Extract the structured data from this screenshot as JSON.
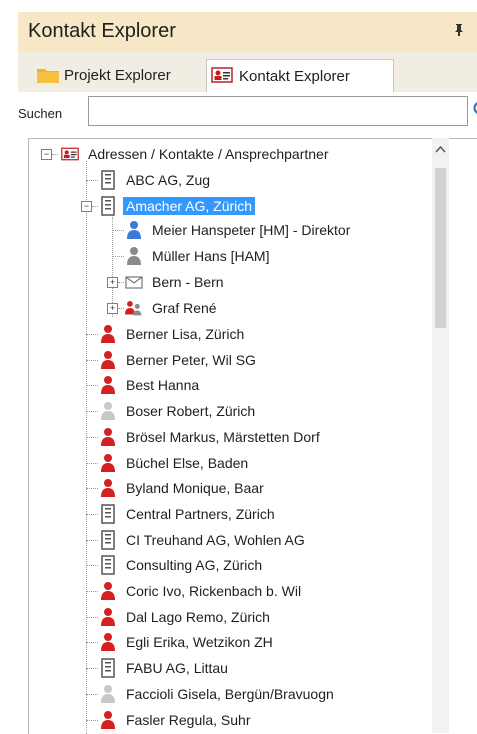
{
  "panel": {
    "title": "Kontakt Explorer",
    "pin_glyph": "↑ ×"
  },
  "tabs": [
    {
      "label": "Projekt Explorer",
      "icon": "folder-icon"
    },
    {
      "label": "Kontakt Explorer",
      "icon": "contact-card-icon",
      "active": true
    }
  ],
  "search": {
    "label": "Suchen",
    "value": "",
    "placeholder": ""
  },
  "tree": {
    "root": {
      "label": "Adressen / Kontakte / Ansprechpartner",
      "icon": "contact-card-icon",
      "expanded": true
    },
    "items": [
      {
        "label": "ABC AG, Zug",
        "icon": "building-icon"
      },
      {
        "label": "Amacher AG, Zürich",
        "icon": "building-icon",
        "selected": true,
        "expanded": true
      },
      {
        "label": "Meier Hanspeter [HM] - Direktor",
        "icon": "person-blue-icon"
      },
      {
        "label": "Müller Hans [HAM]",
        "icon": "person-gray-icon"
      },
      {
        "label": "Bern - Bern",
        "icon": "envelope-icon"
      },
      {
        "label": "Graf René",
        "icon": "people-icon"
      },
      {
        "label": "Berner Lisa, Zürich",
        "icon": "person-red-icon"
      },
      {
        "label": "Berner Peter, Wil SG",
        "icon": "person-red-icon"
      },
      {
        "label": "Best Hanna",
        "icon": "person-red-icon"
      },
      {
        "label": "Boser Robert, Zürich",
        "icon": "person-lightgray-icon"
      },
      {
        "label": "Brösel Markus, Märstetten Dorf",
        "icon": "person-red-icon"
      },
      {
        "label": "Büchel Else, Baden",
        "icon": "person-red-icon"
      },
      {
        "label": "Byland Monique, Baar",
        "icon": "person-red-icon"
      },
      {
        "label": "Central Partners, Zürich",
        "icon": "building-icon"
      },
      {
        "label": "CI Treuhand AG, Wohlen AG",
        "icon": "building-icon"
      },
      {
        "label": "Consulting AG, Zürich",
        "icon": "building-icon"
      },
      {
        "label": "Coric Ivo, Rickenbach b. Wil",
        "icon": "person-red-icon"
      },
      {
        "label": "Dal Lago Remo, Zürich",
        "icon": "person-red-icon"
      },
      {
        "label": "Egli Erika, Wetzikon ZH",
        "icon": "person-red-icon"
      },
      {
        "label": "FABU AG, Littau",
        "icon": "building-icon"
      },
      {
        "label": "Faccioli Gisela, Bergün/Bravuogn",
        "icon": "person-lightgray-icon"
      },
      {
        "label": "Fasler Regula, Suhr",
        "icon": "person-red-icon"
      }
    ]
  },
  "colors": {
    "title_bg": "#f7e7c6",
    "selection": "#3399ff",
    "person_red": "#d42020",
    "person_blue": "#3a7bd5",
    "person_gray": "#8a8a8a"
  }
}
